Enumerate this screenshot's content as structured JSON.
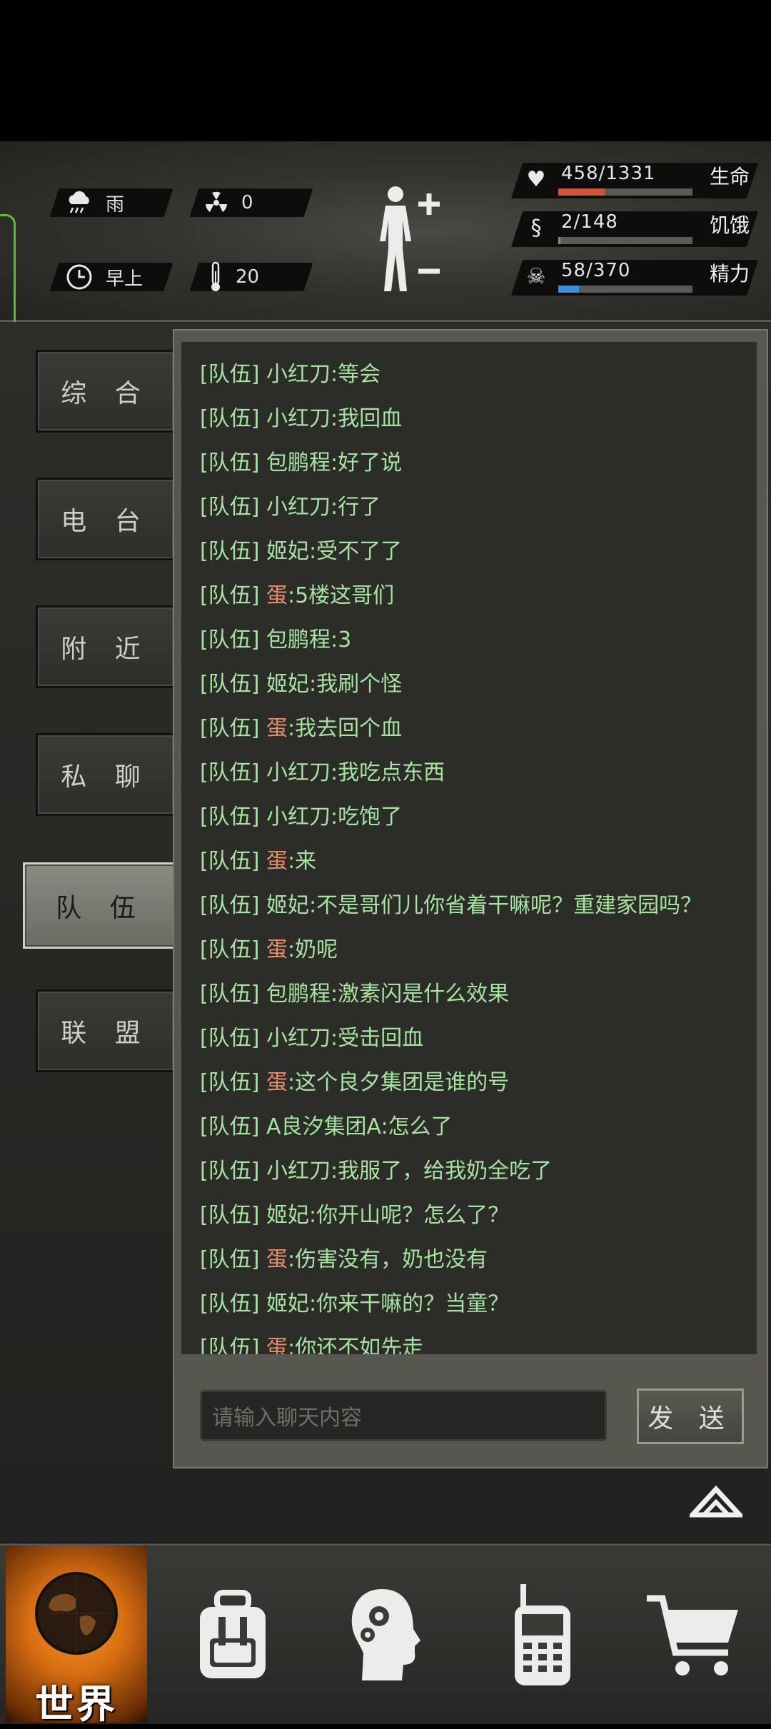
{
  "status": {
    "weather": "雨",
    "radiation": "0",
    "time_of_day": "早上",
    "temperature": "20",
    "stats": [
      {
        "label": "生命",
        "value": "458/1331",
        "current": 458,
        "max": 1331,
        "color": "#d0543c",
        "icon": "heart-pulse-icon"
      },
      {
        "label": "饥饿",
        "value": "2/148",
        "current": 2,
        "max": 148,
        "color": "#8a8a8a",
        "icon": "stomach-icon"
      },
      {
        "label": "精力",
        "value": "58/370",
        "current": 58,
        "max": 370,
        "color": "#3f8fd8",
        "icon": "energy-head-icon"
      }
    ]
  },
  "tabs": [
    {
      "label": "综 合",
      "active": false
    },
    {
      "label": "电 台",
      "active": false
    },
    {
      "label": "附 近",
      "active": false
    },
    {
      "label": "私 聊",
      "active": false
    },
    {
      "label": "队 伍",
      "active": true
    },
    {
      "label": "联 盟",
      "active": false
    }
  ],
  "chat": {
    "channel_prefix": "[队伍]",
    "messages": [
      {
        "name": "小红刀",
        "text": ":等会",
        "orange": false
      },
      {
        "name": "小红刀",
        "text": ":我回血",
        "orange": false
      },
      {
        "name": "包鹏程",
        "text": ":好了说",
        "orange": false
      },
      {
        "name": "小红刀",
        "text": ":行了",
        "orange": false
      },
      {
        "name": "姬妃",
        "text": ":受不了了",
        "orange": false
      },
      {
        "name": "蛋",
        "text": ":5楼这哥们",
        "orange": true
      },
      {
        "name": "包鹏程",
        "text": ":3",
        "orange": false
      },
      {
        "name": "姬妃",
        "text": ":我刷个怪",
        "orange": false
      },
      {
        "name": "蛋",
        "text": ":我去回个血",
        "orange": true
      },
      {
        "name": "小红刀",
        "text": ":我吃点东西",
        "orange": false
      },
      {
        "name": "小红刀",
        "text": ":吃饱了",
        "orange": false
      },
      {
        "name": "蛋",
        "text": ":来",
        "orange": true
      },
      {
        "name": "姬妃",
        "text": ":不是哥们儿你省着干嘛呢？重建家园吗？",
        "orange": false
      },
      {
        "name": "蛋",
        "text": ":奶呢",
        "orange": true
      },
      {
        "name": "包鹏程",
        "text": ":激素闪是什么效果",
        "orange": false
      },
      {
        "name": "小红刀",
        "text": ":受击回血",
        "orange": false
      },
      {
        "name": "蛋",
        "text": ":这个良夕集团是谁的号",
        "orange": true
      },
      {
        "name": "A良汐集团A",
        "text": ":怎么了",
        "orange": false
      },
      {
        "name": "小红刀",
        "text": ":我服了，给我奶全吃了",
        "orange": false
      },
      {
        "name": "姬妃",
        "text": ":你开山呢？怎么了？",
        "orange": false
      },
      {
        "name": "蛋",
        "text": ":伤害没有，奶也没有",
        "orange": true
      },
      {
        "name": "姬妃",
        "text": ":你来干嘛的？当童？",
        "orange": false
      },
      {
        "name": "蛋",
        "text": ":你还不如先走",
        "orange": true
      }
    ],
    "input_placeholder": "请输入聊天内容",
    "send_label": "发 送"
  },
  "bottom_nav": [
    {
      "label": "世界",
      "icon": "globe-icon",
      "active": true
    },
    {
      "label": "",
      "icon": "backpack-icon",
      "active": false
    },
    {
      "label": "",
      "icon": "brain-head-icon",
      "active": false
    },
    {
      "label": "",
      "icon": "walkie-talkie-icon",
      "active": false
    },
    {
      "label": "",
      "icon": "shopping-cart-icon",
      "active": false
    }
  ]
}
